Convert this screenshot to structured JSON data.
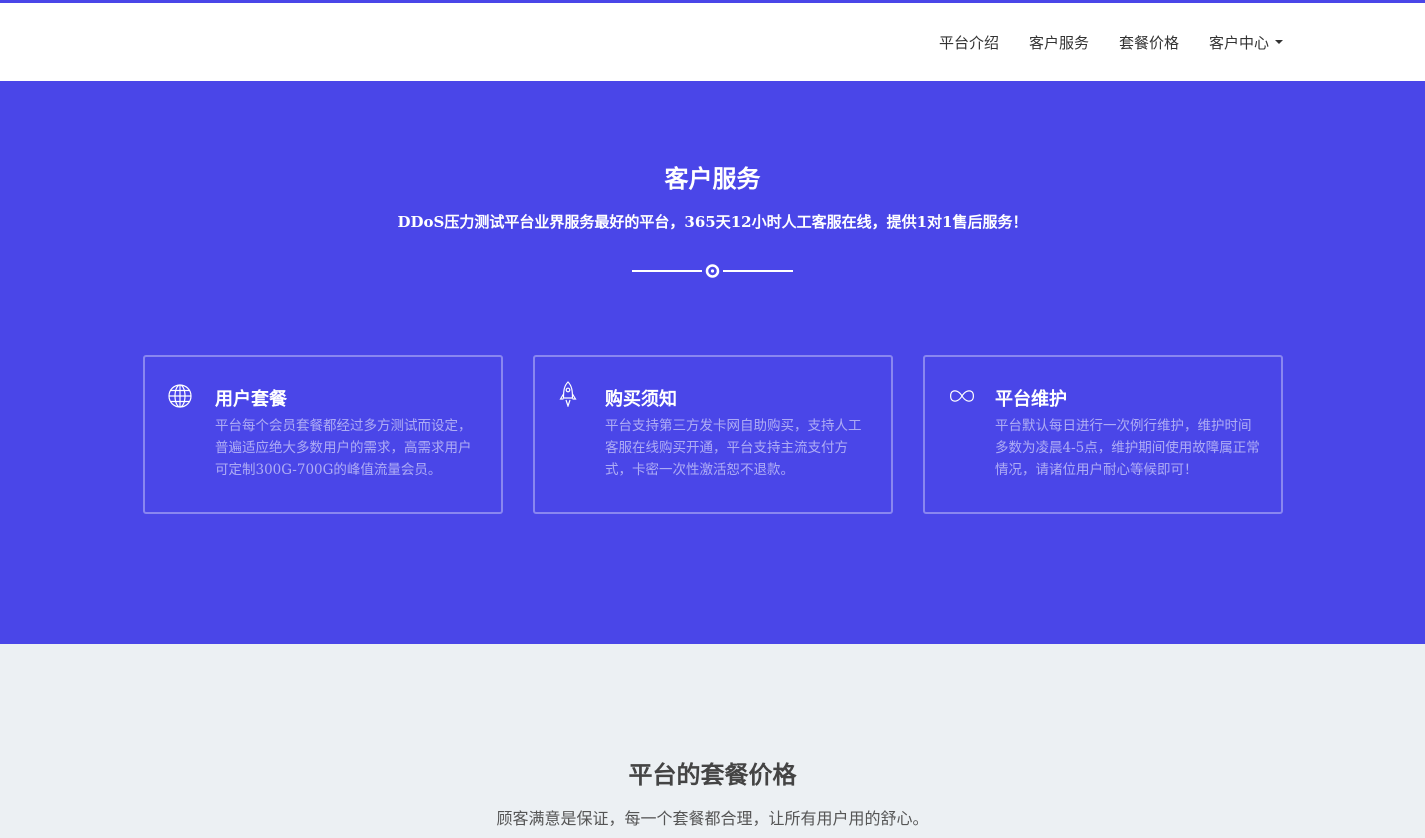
{
  "nav": {
    "items": [
      "平台介绍",
      "客户服务",
      "套餐价格"
    ],
    "dropdown_label": "客户中心"
  },
  "hero": {
    "title": "客户服务",
    "subtitle": "DDoS压力测试平台业界服务最好的平台，365天12小时人工客服在线，提供1对1售后服务！"
  },
  "features": [
    {
      "icon": "globe-icon",
      "title": "用户套餐",
      "text": "平台每个会员套餐都经过多方测试而设定，普遍适应绝大多数用户的需求，高需求用户可定制300G-700G的峰值流量会员。"
    },
    {
      "icon": "rocket-icon",
      "title": "购买须知",
      "text": "平台支持第三方发卡网自助购买，支持人工客服在线购买开通，平台支持主流支付方式，卡密一次性激活恕不退款。"
    },
    {
      "icon": "infinity-icon",
      "title": "平台维护",
      "text": "平台默认每日进行一次例行维护，维护时间多数为凌晨4-5点，维护期间使用故障属正常情况，请诸位用户耐心等候即可！"
    }
  ],
  "pricing": {
    "title": "平台的套餐价格",
    "subtitle": "顾客满意是保证，每一个套餐都合理，让所有用户用的舒心。"
  },
  "colors": {
    "accent": "#4a46e8",
    "page_bg": "#ecf0f3",
    "nav_bg": "#ffffff"
  }
}
